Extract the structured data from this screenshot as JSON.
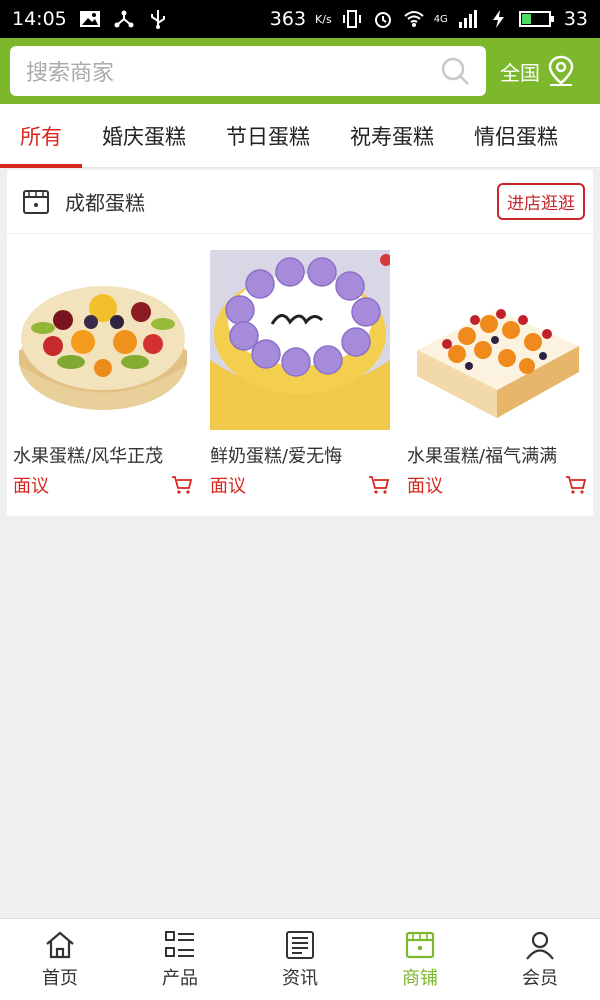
{
  "statusbar": {
    "time": "14:05",
    "speed": "363",
    "speed_unit": "K/s",
    "network": "4G",
    "battery": "33"
  },
  "search": {
    "placeholder": "搜索商家"
  },
  "region": {
    "label": "全国"
  },
  "tabs": [
    {
      "label": "所有",
      "active": true
    },
    {
      "label": "婚庆蛋糕"
    },
    {
      "label": "节日蛋糕"
    },
    {
      "label": "祝寿蛋糕"
    },
    {
      "label": "情侣蛋糕"
    }
  ],
  "shop": {
    "name": "成都蛋糕",
    "enter_label": "进店逛逛",
    "products": [
      {
        "name": "水果蛋糕/风华正茂",
        "price": "面议",
        "icon": "cart-icon"
      },
      {
        "name": "鲜奶蛋糕/爱无悔",
        "price": "面议",
        "icon": "cart-icon"
      },
      {
        "name": "水果蛋糕/福气满满",
        "price": "面议",
        "icon": "cart-icon"
      }
    ]
  },
  "nav": [
    {
      "label": "首页",
      "icon": "home-icon"
    },
    {
      "label": "产品",
      "icon": "list-icon"
    },
    {
      "label": "资讯",
      "icon": "news-icon"
    },
    {
      "label": "商铺",
      "icon": "store-icon",
      "active": true
    },
    {
      "label": "会员",
      "icon": "user-icon"
    }
  ],
  "colors": {
    "brand": "#7cb72c",
    "accent": "#d7261e"
  }
}
